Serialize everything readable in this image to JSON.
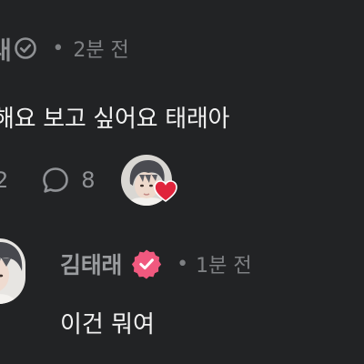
{
  "comment1": {
    "author": "래",
    "time": "2분 전",
    "text": "해요 보고 싶어요 태래아",
    "like_count": "2",
    "reply_count": "8"
  },
  "comment2": {
    "author": "김태래",
    "time": "1분 전",
    "text": "이건 뭐여"
  },
  "colors": {
    "background": "#222325",
    "badge": "#f0597f",
    "heart": "#e0243c"
  }
}
